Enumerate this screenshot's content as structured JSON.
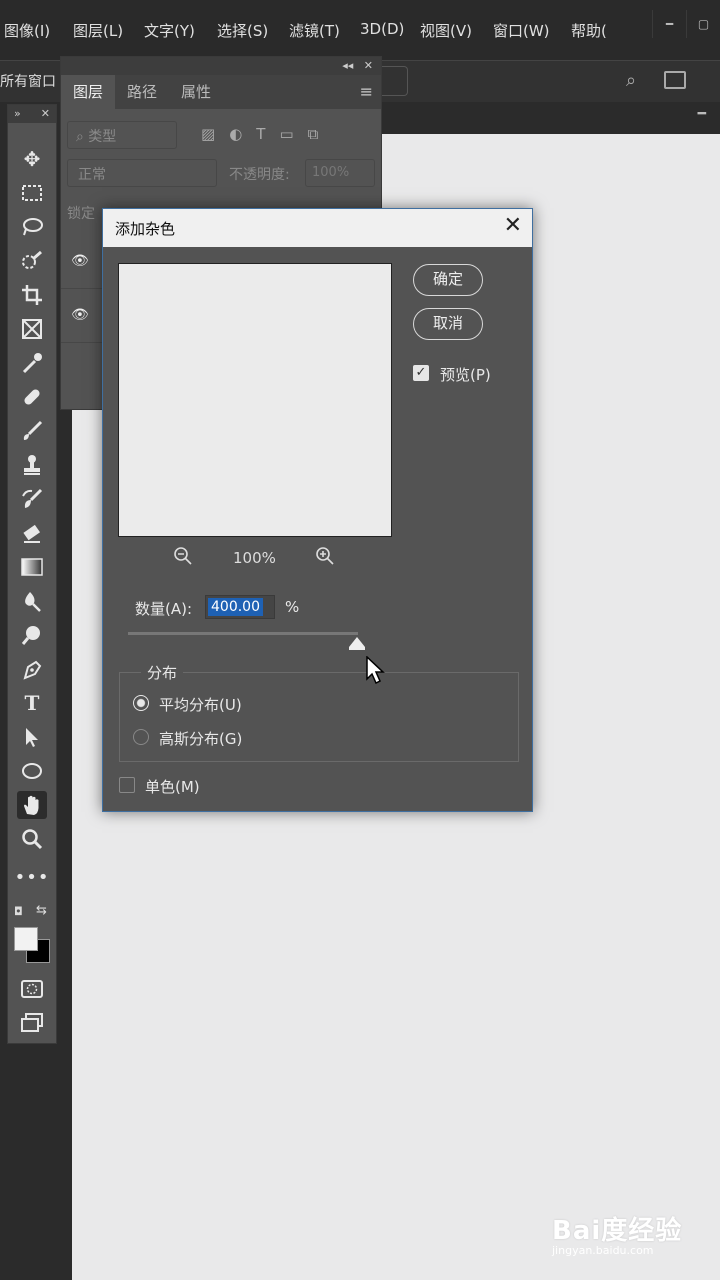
{
  "menubar": {
    "items": [
      "图像(I)",
      "图层(L)",
      "文字(Y)",
      "选择(S)",
      "滤镜(T)",
      "3D(D)",
      "视图(V)",
      "窗口(W)",
      "帮助("
    ]
  },
  "optionsbar": {
    "workspace_label": "所有窗口"
  },
  "layers_panel": {
    "tabs": [
      "图层",
      "路径",
      "属性"
    ],
    "filter_placeholder": "类型",
    "blend_mode": "正常",
    "opacity_label": "不透明度:",
    "opacity_value": "100%",
    "lock_label": "锁定"
  },
  "dialog": {
    "title": "添加杂色",
    "ok_label": "确定",
    "cancel_label": "取消",
    "preview_label": "预览(P)",
    "preview_checked": true,
    "zoom_label": "100%",
    "amount_label": "数量(A):",
    "amount_value": "400.00",
    "amount_unit": "%",
    "amount_slider_level": 1.0,
    "distribution_title": "分布",
    "uniform_label": "平均分布(U)",
    "gaussian_label": "高斯分布(G)",
    "uniform_selected": true,
    "mono_label": "单色(M)",
    "mono_checked": false
  },
  "toolbar": {
    "tools": [
      "move-icon",
      "marquee-icon",
      "lasso-icon",
      "quick-select-icon",
      "crop-icon",
      "frame-icon",
      "eyedropper-icon",
      "healing-icon",
      "brush-icon",
      "stamp-icon",
      "history-brush-icon",
      "eraser-icon",
      "gradient-icon",
      "blur-icon",
      "dodge-icon",
      "pen-icon",
      "type-icon",
      "path-select-icon",
      "ellipse-icon",
      "hand-icon",
      "zoom-icon",
      "more-tools-icon"
    ],
    "active_tool": "hand-icon",
    "foreground_color": "#f2f2f2",
    "background_color": "#000000"
  },
  "watermark": {
    "logo": "Bai度经验",
    "sub": "jingyan.baidu.com"
  },
  "colors": {
    "menubar": "#2a2a2a",
    "panel": "#535353",
    "canvas": "#e9e9ea",
    "dialog_border": "#3f6fa0",
    "selection": "#1e61b4"
  }
}
